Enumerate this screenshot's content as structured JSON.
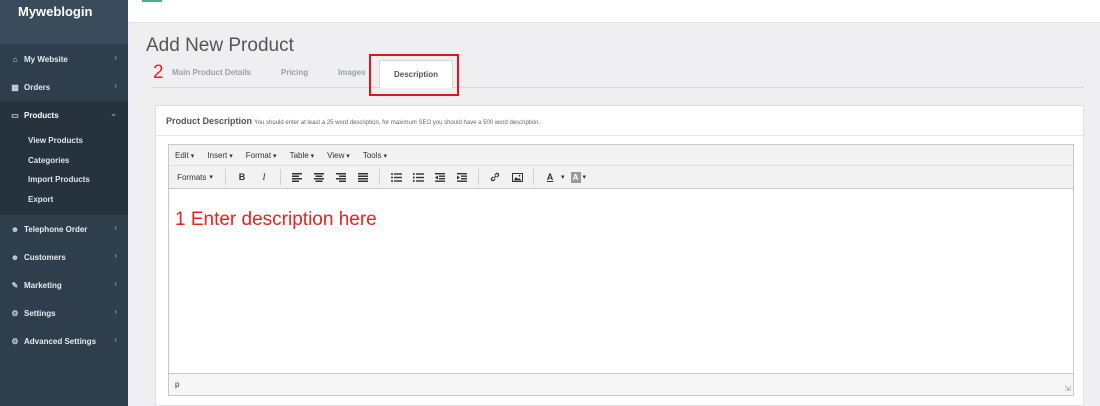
{
  "brand": "Myweblogin",
  "sidebar": {
    "items": [
      {
        "label": "My Website",
        "icon": "home-icon"
      },
      {
        "label": "Orders",
        "icon": "bar-chart-icon"
      },
      {
        "label": "Products",
        "icon": "monitor-icon"
      },
      {
        "label": "Telephone Order",
        "icon": "users-icon"
      },
      {
        "label": "Customers",
        "icon": "users-icon"
      },
      {
        "label": "Marketing",
        "icon": "wrench-icon"
      },
      {
        "label": "Settings",
        "icon": "gear-icon"
      },
      {
        "label": "Advanced Settings",
        "icon": "gears-icon"
      }
    ],
    "products_sub": [
      "View Products",
      "Categories",
      "Import Products",
      "Export"
    ]
  },
  "page": {
    "title": "Add New Product"
  },
  "tabs": [
    "Main Product Details",
    "Pricing",
    "Images",
    "Description"
  ],
  "annotations": {
    "mark_2": "2",
    "mark_1": "1 Enter description here"
  },
  "card": {
    "title": "Product Description",
    "hint": "You should enter at least a 25 word description, for maximum SEO you should have a 500 word description."
  },
  "editor": {
    "menus": [
      "Edit",
      "Insert",
      "Format",
      "Table",
      "View",
      "Tools"
    ],
    "formats_label": "Formats",
    "bold": "B",
    "italic": "I",
    "text_color": "A",
    "bg_color": "A",
    "status_path": "p"
  },
  "colors": {
    "sidebar": "#2f3e4d",
    "annotation_red": "#e8221c",
    "accent_green": "#45b37f"
  }
}
